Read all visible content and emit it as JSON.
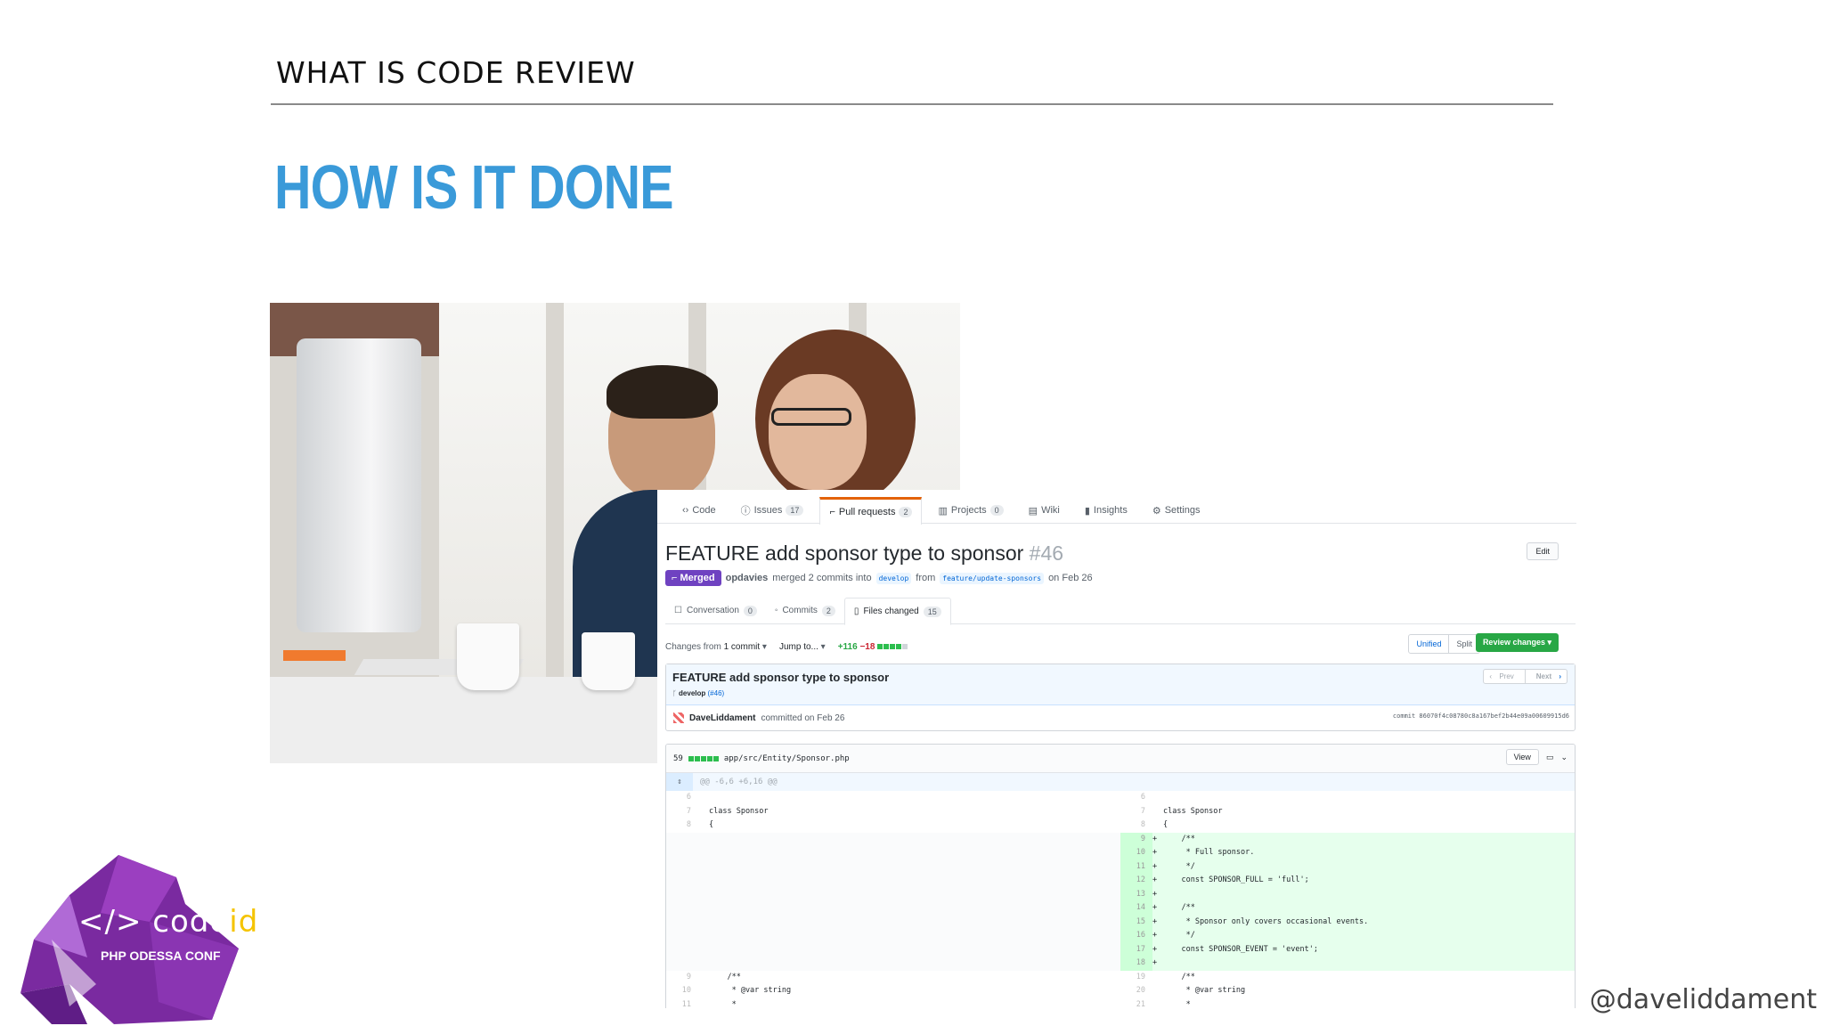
{
  "slide": {
    "section_title": "WHAT IS CODE REVIEW",
    "heading": "HOW IS IT DONE",
    "handle": "@daveliddament"
  },
  "logo": {
    "mark": "</>",
    "word_a": "code",
    "word_b": "id",
    "sub": "PHP ODESSA CONF"
  },
  "github": {
    "repo_tabs": [
      {
        "label": "Code",
        "icon": "code-icon"
      },
      {
        "label": "Issues",
        "count": "17",
        "icon": "issue-icon"
      },
      {
        "label": "Pull requests",
        "count": "2",
        "icon": "pull-request-icon",
        "active": true
      },
      {
        "label": "Projects",
        "count": "0",
        "icon": "project-icon"
      },
      {
        "label": "Wiki",
        "icon": "book-icon"
      },
      {
        "label": "Insights",
        "icon": "graph-icon"
      },
      {
        "label": "Settings",
        "icon": "gear-icon"
      }
    ],
    "pr": {
      "title": "FEATURE add sponsor type to sponsor",
      "number": "#46",
      "edit": "Edit",
      "status": "Merged",
      "author": "opdavies",
      "merged_text": "merged 2 commits into",
      "base": "develop",
      "from": "from",
      "head": "feature/update-sponsors",
      "date": "on Feb 26"
    },
    "pr_tabs": [
      {
        "label": "Conversation",
        "count": "0"
      },
      {
        "label": "Commits",
        "count": "2"
      },
      {
        "label": "Files changed",
        "count": "15"
      }
    ],
    "toolbar": {
      "changes_from": "Changes from",
      "commit_sel": "1 commit",
      "jump": "Jump to...",
      "additions": "+116",
      "deletions": "−18",
      "unified": "Unified",
      "split": "Split",
      "review": "Review changes"
    },
    "commit": {
      "title": "FEATURE add sponsor type to sponsor",
      "branch": "develop",
      "branch_ref": "(#46)",
      "prev": "Prev",
      "next": "Next",
      "author": "DaveLiddament",
      "committed": "committed on Feb 26",
      "sha": "commit 86070f4c08780c8a167bef2b44e09a00609915d6"
    },
    "file": {
      "changes": "59",
      "path": "app/src/Entity/Sponsor.php",
      "view": "View",
      "hunk": "@@ -6,6 +6,16 @@"
    },
    "diff_left": [
      {
        "no": "6",
        "code": ""
      },
      {
        "no": "7",
        "code": "class Sponsor"
      },
      {
        "no": "8",
        "code": "{"
      }
    ],
    "diff_right": [
      {
        "no": "6",
        "code": ""
      },
      {
        "no": "7",
        "code": "class Sponsor"
      },
      {
        "no": "8",
        "code": "{"
      },
      {
        "no": "9",
        "code": "    /**"
      },
      {
        "no": "10",
        "code": "     * Full sponsor."
      },
      {
        "no": "11",
        "code": "     */"
      },
      {
        "no": "12",
        "code": "    const SPONSOR_FULL = 'full';"
      },
      {
        "no": "13",
        "code": ""
      },
      {
        "no": "14",
        "code": "    /**"
      },
      {
        "no": "15",
        "code": "     * Sponsor only covers occasional events."
      },
      {
        "no": "16",
        "code": "     */"
      },
      {
        "no": "17",
        "code": "    const SPONSOR_EVENT = 'event';"
      },
      {
        "no": "18",
        "code": ""
      }
    ],
    "diff_tail_left": [
      {
        "no": "9",
        "code": "    /**"
      },
      {
        "no": "10",
        "code": "     * @var string"
      },
      {
        "no": "11",
        "code": "     *"
      }
    ],
    "diff_tail_right": [
      {
        "no": "19",
        "code": "    /**"
      },
      {
        "no": "20",
        "code": "     * @var string"
      },
      {
        "no": "21",
        "code": "     *"
      }
    ]
  }
}
